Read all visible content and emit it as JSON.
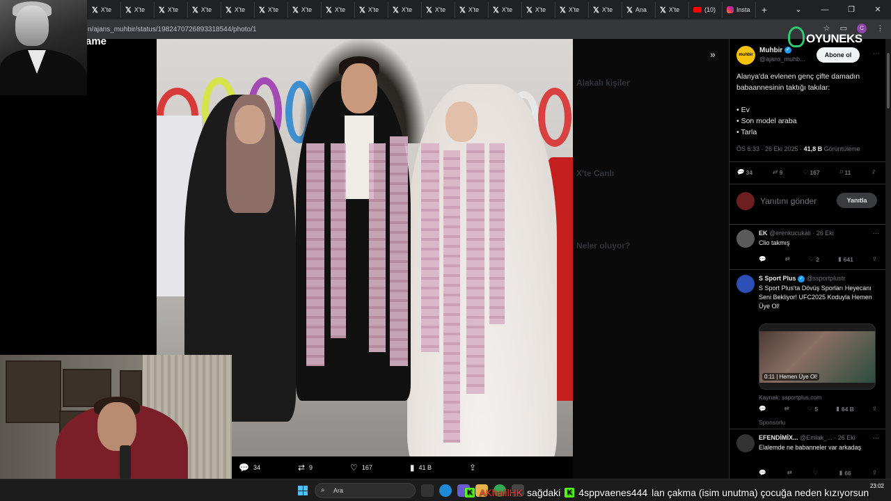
{
  "browser": {
    "tabs": [
      {
        "label": "X'te",
        "icon": "x-icon"
      },
      {
        "label": "X'te",
        "icon": "x-icon"
      },
      {
        "label": "X'te",
        "icon": "x-icon"
      },
      {
        "label": "X'te",
        "icon": "x-icon"
      },
      {
        "label": "X'te",
        "icon": "x-icon"
      },
      {
        "label": "X'te",
        "icon": "x-icon"
      },
      {
        "label": "X'te",
        "icon": "x-icon"
      },
      {
        "label": "X'te",
        "icon": "x-icon"
      },
      {
        "label": "X'te",
        "icon": "x-icon"
      },
      {
        "label": "X'te",
        "icon": "x-icon"
      },
      {
        "label": "X'te",
        "icon": "x-icon"
      },
      {
        "label": "X'te",
        "icon": "x-icon"
      },
      {
        "label": "X'te",
        "icon": "x-icon"
      },
      {
        "label": "X'te",
        "icon": "x-icon"
      },
      {
        "label": "X'te",
        "icon": "x-icon"
      },
      {
        "label": "X'te",
        "icon": "x-icon"
      },
      {
        "label": "Ana",
        "icon": "x-icon"
      },
      {
        "label": "X'te",
        "icon": "x-icon"
      },
      {
        "label": "(10)",
        "icon": "youtube-icon"
      },
      {
        "label": "Insta",
        "icon": "instagram-icon"
      }
    ],
    "new_tab": "+",
    "url": "n/ajans_muhbir/status/1982470726893318544/photo/1",
    "profile_initial": "C",
    "window_controls": [
      "⌄",
      "—",
      "❐",
      "✕"
    ]
  },
  "left": {
    "title_fragment": "ame"
  },
  "photo_bar": {
    "replies": "34",
    "reposts": "9",
    "likes": "167",
    "views": "41 B"
  },
  "logo": {
    "text": "OYUNEKS"
  },
  "tweet": {
    "avatar_text": "muhbir",
    "name": "Muhbir",
    "handle": "@ajans_muhb...",
    "subscribe": "Abone ol",
    "text_line1": "Alanya'da evlenen genç çifte damadın babaannesinin taktığı takılar:",
    "items": [
      "• Ev",
      "• Son model araba",
      "• Tarla"
    ],
    "time": "ÖS 6:33 · 26 Eki 2025 · ",
    "views_value": "41,8 B",
    "views_label": " Görüntüleme",
    "replies": "34",
    "reposts": "9",
    "likes": "167",
    "bookmarks": "11"
  },
  "reply_box": {
    "placeholder": "Yanıtını gönder",
    "button": "Yanıtla"
  },
  "replies": [
    {
      "name": "EK",
      "handle": "@erenkucukali · 26 Eki",
      "text": "Clio takmış",
      "stats": {
        "replies": "",
        "reposts": "",
        "likes": "2",
        "views": "641"
      }
    },
    {
      "name": "S Sport Plus",
      "handle": "@ssportplustr",
      "text": "S Sport Plus'ta Dövüş Sporları Heyecanı Seni Bekliyor! UFC2025 Koduyla Hemen Üye Ol!",
      "video_caption": "0:11  |  Hemen Üye Ol!",
      "source": "Kaynak: ssportplus.com",
      "stats": {
        "replies": "",
        "reposts": "",
        "likes": "5",
        "views": "64 B"
      },
      "sponsored": "Sponsorlu"
    },
    {
      "name": "EFENDİMİX...",
      "handle": "@Emlak_... · 26 Eki",
      "text": "Elalemde ne babanneler var arkadaş",
      "stats": {
        "replies": "",
        "reposts": "",
        "likes": "",
        "views": "66"
      }
    }
  ],
  "background_ghost": {
    "related": "Alakalı kişiler",
    "live": "X'te Canlı",
    "happening": "Neler oluyor?"
  },
  "taskbar": {
    "search_placeholder": "Ara",
    "time": "23:02"
  },
  "chat_ticker": {
    "user": "AKhalilHK",
    "text1": "sağdaki",
    "user2": "4sppvaenes444",
    "text2": "lan çakma (isim unutma) çocuğa neden kızıyorsun"
  }
}
